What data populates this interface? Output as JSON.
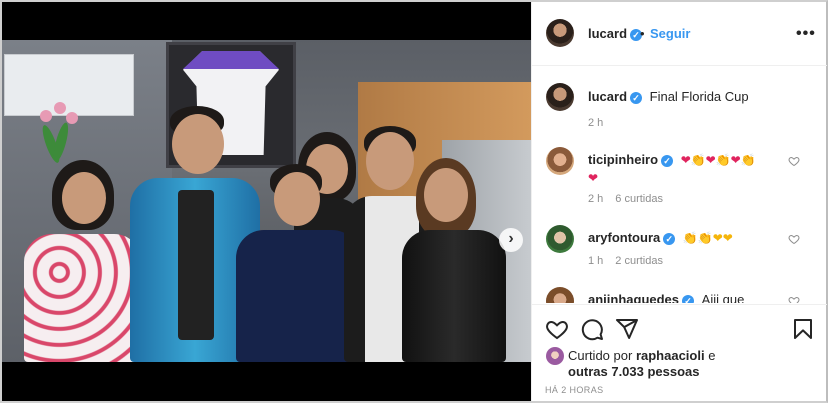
{
  "post": {
    "author": "lucard",
    "follow_label": "Seguir",
    "separator": "•",
    "more_label": "•••",
    "caption_author": "lucard",
    "caption": "Final Florida Cup",
    "caption_time": "2 h",
    "carousel_next": "›"
  },
  "comments": [
    {
      "user": "ticipinheiro",
      "text": "❤👏❤👏❤👏",
      "text2": "❤",
      "time": "2 h",
      "likes": "6 curtidas"
    },
    {
      "user": "aryfontoura",
      "text": "👏👏❤❤",
      "time": "1 h",
      "likes": "2 curtidas"
    },
    {
      "user": "aniinhaguedes",
      "text": "Aiii que legal!!!"
    }
  ],
  "likes": {
    "prefix": "Curtido por",
    "user": "raphaacioli",
    "suffix": "e",
    "others": "outras 7.033 pessoas"
  },
  "timestamp": "HÁ 2 HORAS",
  "icons": [
    "heart-icon",
    "comment-icon",
    "share-icon",
    "bookmark-icon",
    "verified-icon",
    "tag-people-icon",
    "chevron-right-icon",
    "more-options-icon"
  ],
  "colors": {
    "link": "#3897f0",
    "text": "#262626",
    "muted": "#8e8e8e",
    "heart": "#e0245e"
  }
}
